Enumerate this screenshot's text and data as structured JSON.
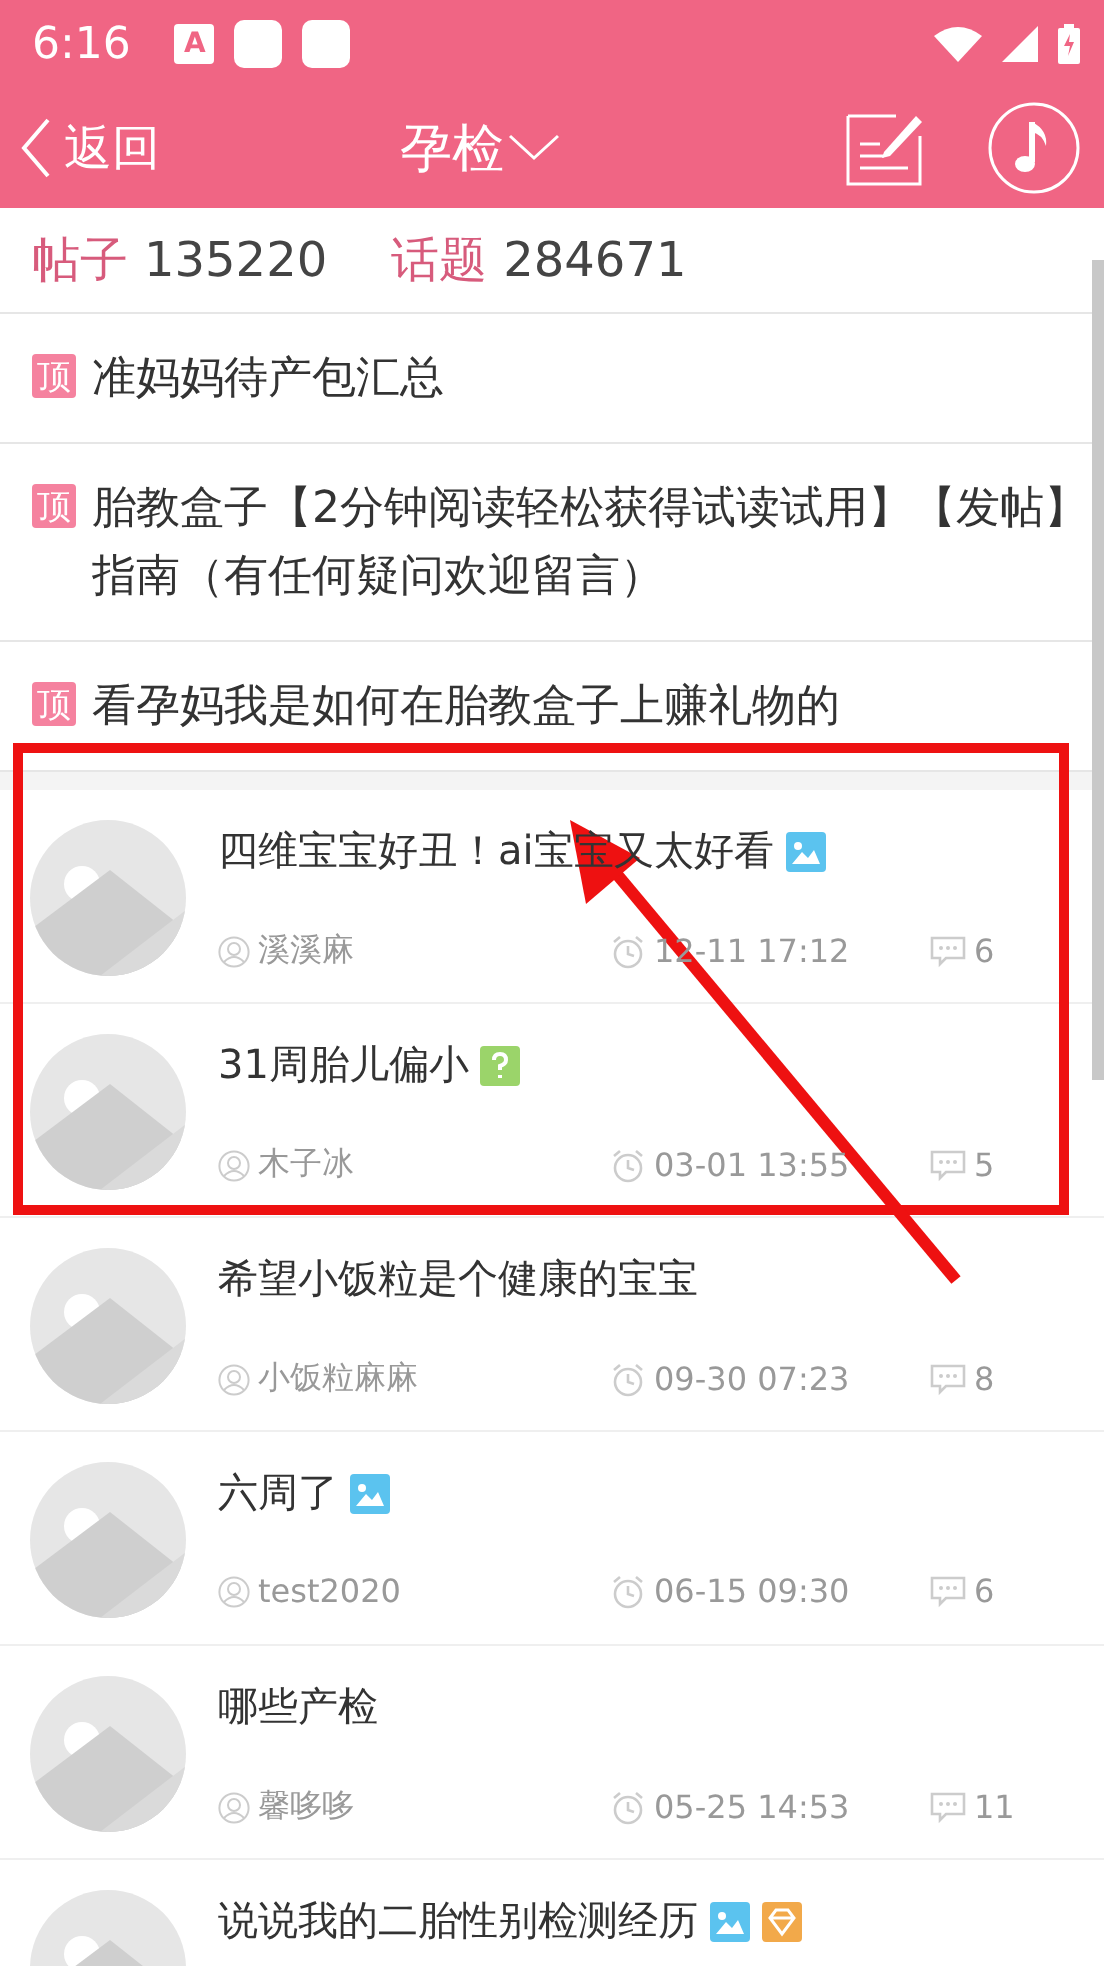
{
  "status_bar": {
    "time": "6:16",
    "notification_letter": "A"
  },
  "nav": {
    "back": "返回",
    "title": "孕检"
  },
  "stats": [
    {
      "label": "帖子",
      "value": "135220"
    },
    {
      "label": "话题",
      "value": "284671"
    }
  ],
  "pinned": [
    {
      "badge": "顶",
      "text": "准妈妈待产包汇总"
    },
    {
      "badge": "顶",
      "text": "胎教盒子【2分钟阅读轻松获得试读试用】【发帖】指南（有任何疑问欢迎留言）"
    },
    {
      "badge": "顶",
      "text": "看孕妈我是如何在胎教盒子上赚礼物的"
    }
  ],
  "posts": [
    {
      "title": "四维宝宝好丑！ai宝宝又太好看",
      "tags": [
        {
          "kind": "image"
        }
      ],
      "author": "溪溪麻",
      "time": "12-11 17:12",
      "comments": "6"
    },
    {
      "title": "31周胎儿偏小",
      "tags": [
        {
          "kind": "question"
        }
      ],
      "author": "木子冰",
      "time": "03-01 13:55",
      "comments": "5"
    },
    {
      "title": "希望小饭粒是个健康的宝宝",
      "author": "小饭粒麻麻",
      "time": "09-30 07:23",
      "comments": "8"
    },
    {
      "title": "六周了",
      "tags": [
        {
          "kind": "image"
        }
      ],
      "author": "test2020",
      "time": "06-15 09:30",
      "comments": "6"
    },
    {
      "title": "哪些产检",
      "author": "馨哆哆",
      "time": "05-25 14:53",
      "comments": "11"
    },
    {
      "title": "说说我的二胎性别检测经历",
      "tags": [
        {
          "kind": "image"
        },
        {
          "kind": "gem"
        }
      ]
    }
  ]
}
